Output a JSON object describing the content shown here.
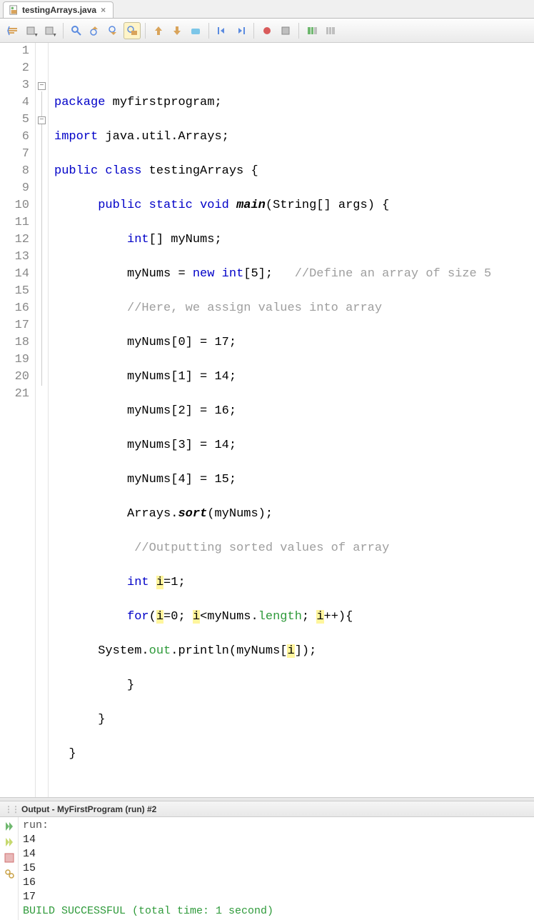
{
  "tab": {
    "filename": "testingArrays.java"
  },
  "lineNumbers": [
    "1",
    "2",
    "3",
    "4",
    "5",
    "6",
    "7",
    "8",
    "9",
    "10",
    "11",
    "12",
    "13",
    "14",
    "15",
    "16",
    "17",
    "18",
    "19",
    "20",
    "21"
  ],
  "code": {
    "l2": {
      "kw": "package",
      "rest": " myfirstprogram;"
    },
    "l3": {
      "kw": "import",
      "rest": " java.util.Arrays;"
    },
    "l4": {
      "kw1": "public",
      "kw2": "class",
      "name": " testingArrays ",
      "brace": "{"
    },
    "l5": {
      "kw1": "public",
      "kw2": "static",
      "kw3": "void",
      "fn": "main",
      "args": "(String[] args) {"
    },
    "l6": {
      "kw": "int",
      "rest": "[] myNums;"
    },
    "l7": {
      "a": "myNums = ",
      "kw1": "new",
      "kw2": "int",
      "b": "[5];   ",
      "cm": "//Define an array of size 5"
    },
    "l8": {
      "cm": "//Here, we assign values into array"
    },
    "l9": "myNums[0] = 17;",
    "l10": "myNums[1] = 14;",
    "l11": "myNums[2] = 16;",
    "l12": "myNums[3] = 14;",
    "l13": "myNums[4] = 15;",
    "l14": {
      "a": "Arrays.",
      "fn": "sort",
      "b": "(myNums);"
    },
    "l15": {
      "cm": " //Outputting sorted values of array"
    },
    "l16": {
      "kw": "int",
      "sp": " ",
      "hl": "i",
      "rest": "=1;"
    },
    "l17": {
      "kw": "for",
      "a": "(",
      "h1": "i",
      "b": "=0; ",
      "h2": "i",
      "c": "<myNums.",
      "fld": "length",
      "d": "; ",
      "h3": "i",
      "e": "++){"
    },
    "l18": {
      "a": "System.",
      "fld": "out",
      "b": ".println(myNums[",
      "hl": "i",
      "c": "]);"
    },
    "l19": "}",
    "l20": "}",
    "l21": "}"
  },
  "output": {
    "title": "Output - MyFirstProgram (run) #2",
    "lines": {
      "run": "run:",
      "r1": "14",
      "r2": "14",
      "r3": "15",
      "r4": "16",
      "r5": "17",
      "build": "BUILD SUCCESSFUL (total time: 1 second)"
    }
  }
}
